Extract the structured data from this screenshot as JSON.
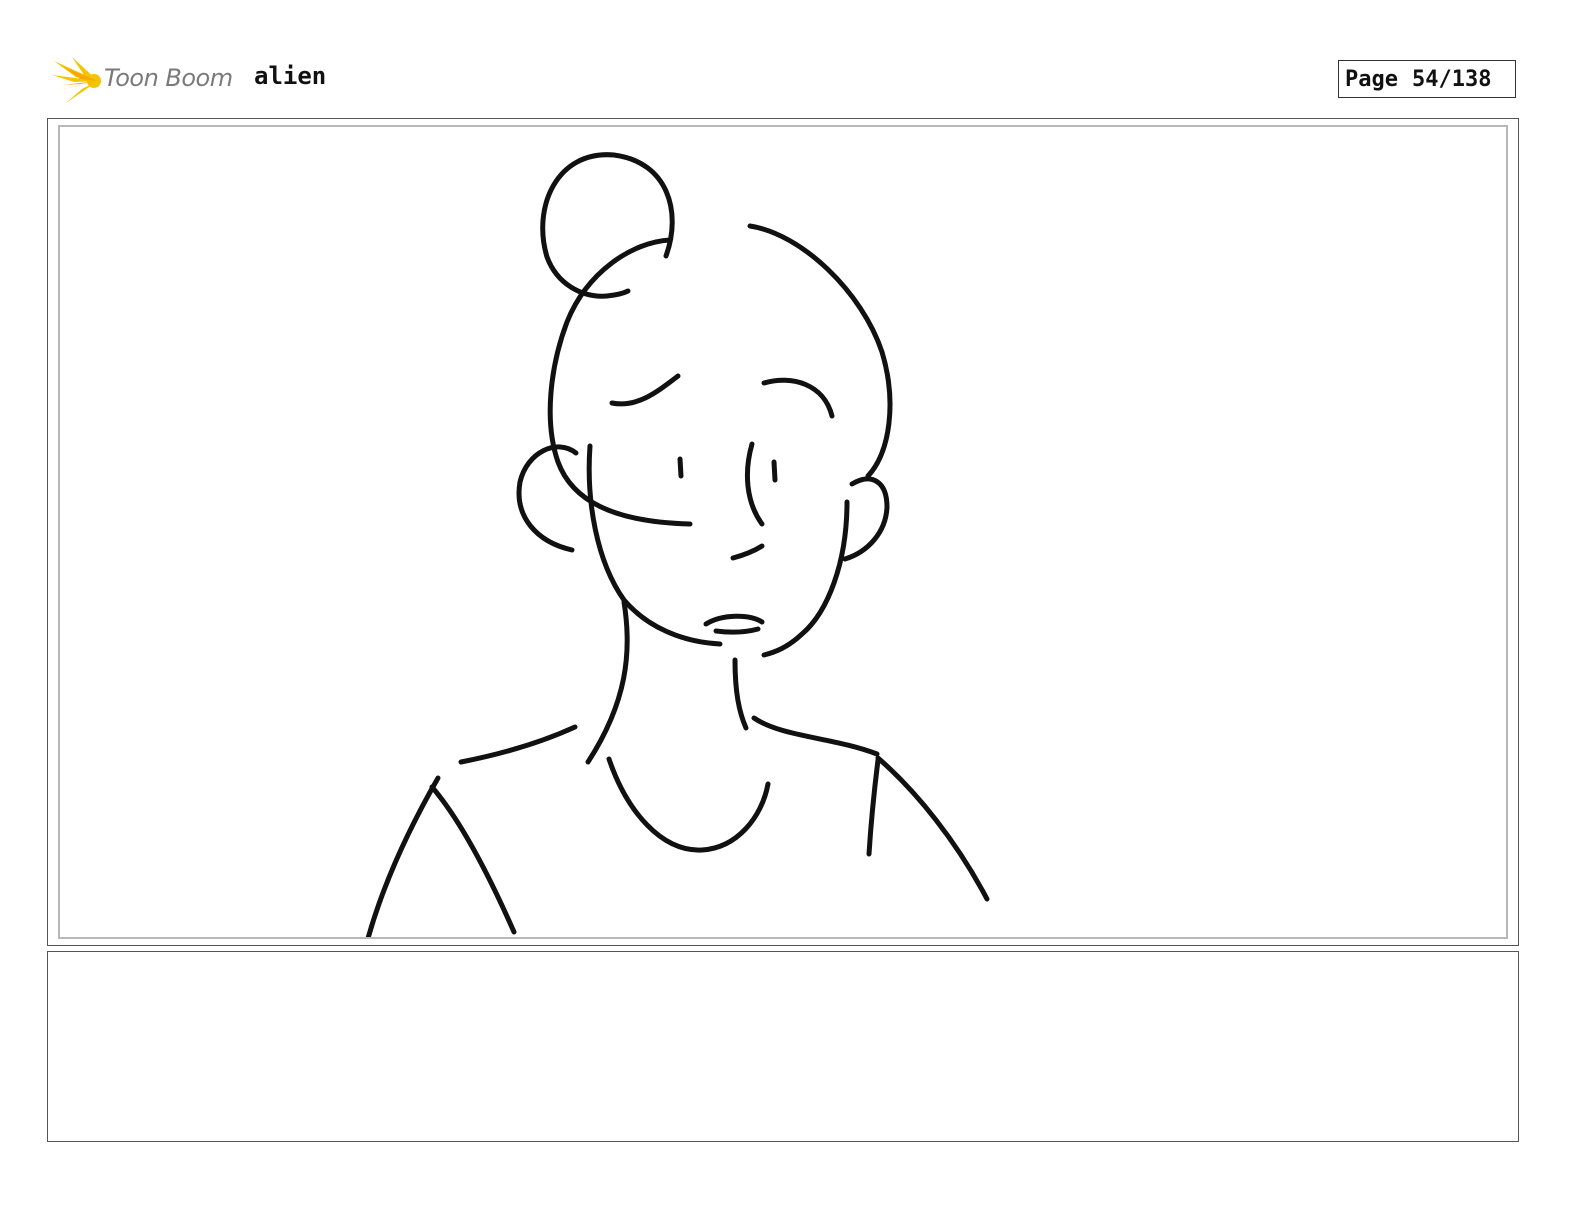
{
  "header": {
    "logo_text": "Toon Boom",
    "project_title": "alien",
    "page_label": "Page",
    "page_number": "54/138"
  },
  "panel": {
    "drawing": "sketch-character-icon"
  },
  "notes": {
    "text": ""
  },
  "colors": {
    "logo_yellow": "#f5c400",
    "logo_text": "#7a7a7a",
    "ink": "#111111"
  }
}
